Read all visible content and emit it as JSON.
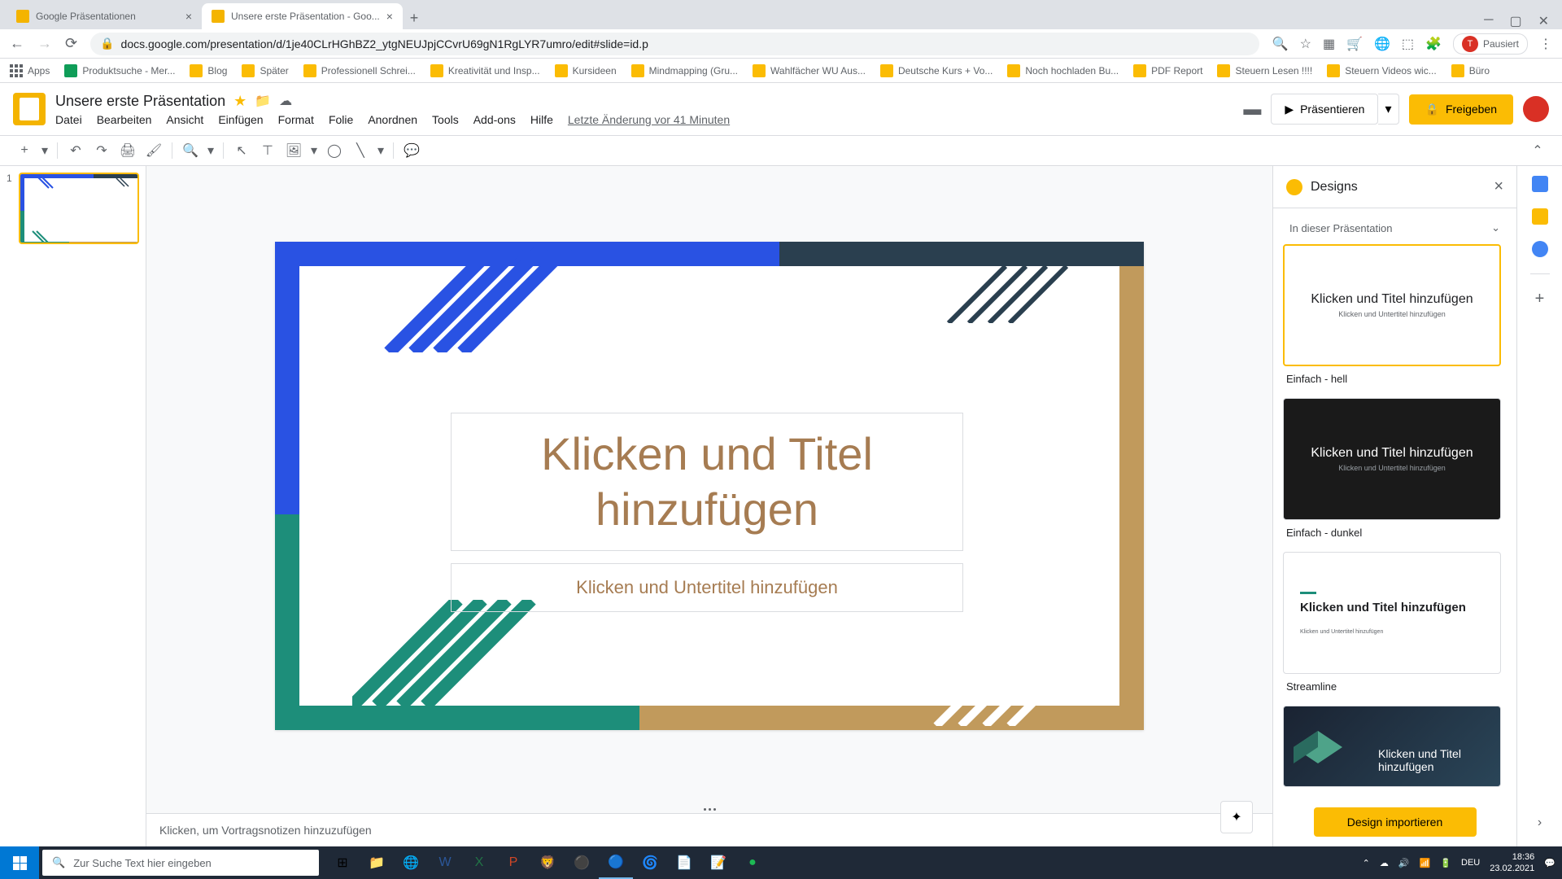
{
  "browser": {
    "tabs": [
      {
        "title": "Google Präsentationen"
      },
      {
        "title": "Unsere erste Präsentation - Goo..."
      }
    ],
    "url": "docs.google.com/presentation/d/1je40CLrHGhBZ2_ytgNEUJpjCCvrU69gN1RgLYR7umro/edit#slide=id.p",
    "pausiert": "Pausiert"
  },
  "bookmarks": [
    "Apps",
    "Produktsuche - Mer...",
    "Blog",
    "Später",
    "Professionell Schrei...",
    "Kreativität und Insp...",
    "Kursideen",
    "Mindmapping (Gru...",
    "Wahlfächer WU Aus...",
    "Deutsche Kurs + Vo...",
    "Noch hochladen Bu...",
    "PDF Report",
    "Steuern Lesen !!!!",
    "Steuern Videos wic...",
    "Büro"
  ],
  "doc": {
    "title": "Unsere erste Präsentation",
    "menus": [
      "Datei",
      "Bearbeiten",
      "Ansicht",
      "Einfügen",
      "Format",
      "Folie",
      "Anordnen",
      "Tools",
      "Add-ons",
      "Hilfe"
    ],
    "last_edit": "Letzte Änderung vor 41 Minuten",
    "present": "Präsentieren",
    "share": "Freigeben"
  },
  "slide": {
    "number": "1",
    "title_placeholder": "Klicken und Titel hinzufügen",
    "subtitle_placeholder": "Klicken und Untertitel hinzufügen",
    "notes_placeholder": "Klicken, um Vortragsnotizen hinzuzufügen"
  },
  "designs": {
    "title": "Designs",
    "dropdown": "In dieser Präsentation",
    "themes": [
      {
        "name": "Einfach - hell",
        "title": "Klicken und Titel hinzufügen",
        "sub": "Klicken und Untertitel hinzufügen"
      },
      {
        "name": "Einfach - dunkel",
        "title": "Klicken und Titel hinzufügen",
        "sub": "Klicken und Untertitel hinzufügen"
      },
      {
        "name": "Streamline",
        "title": "Klicken und Titel hinzufügen",
        "sub": "Klicken und Untertitel hinzufügen"
      },
      {
        "name": "",
        "title": "Klicken und Titel hinzufügen",
        "sub": ""
      }
    ],
    "import": "Design importieren"
  },
  "taskbar": {
    "search_placeholder": "Zur Suche Text hier eingeben",
    "lang": "DEU",
    "time": "18:36",
    "date": "23.02.2021"
  }
}
